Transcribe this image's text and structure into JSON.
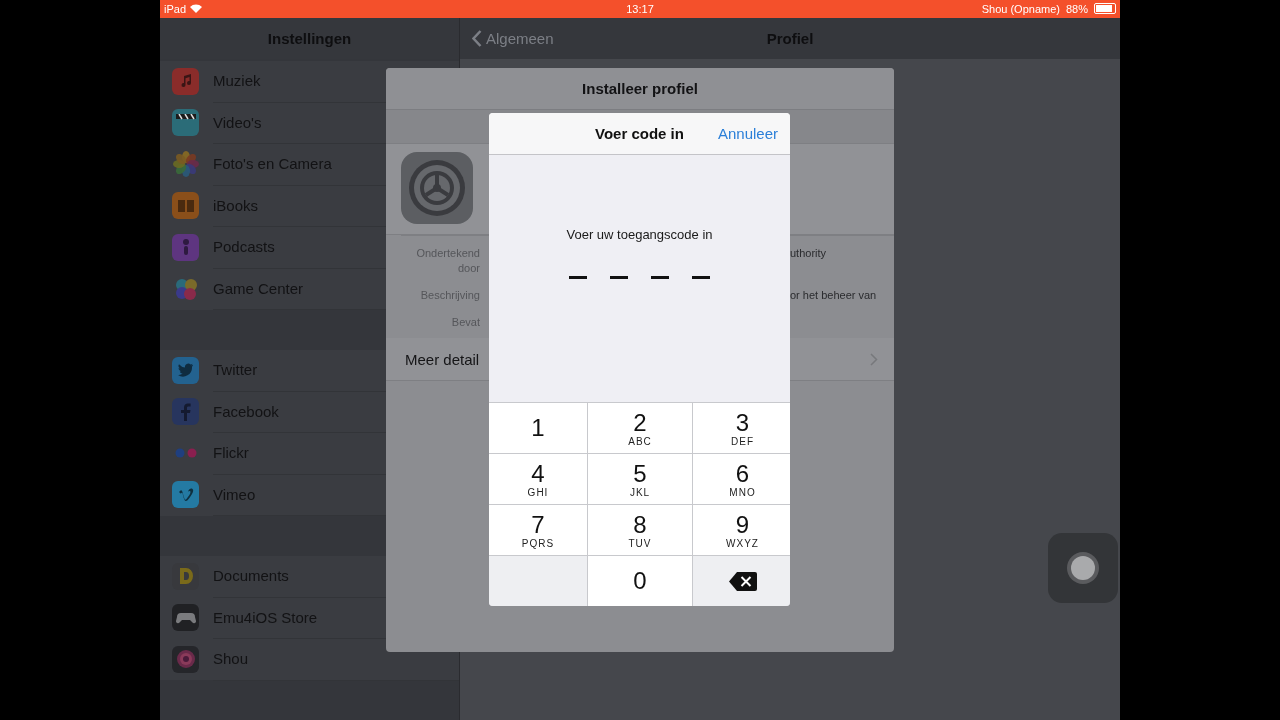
{
  "status_bar": {
    "device": "iPad",
    "time": "13:17",
    "recording": "Shou (Opname)",
    "battery": "88%"
  },
  "nav": {
    "master_title": "Instellingen",
    "back": "Algemeen",
    "detail_title": "Profiel"
  },
  "sidebar": {
    "groups": [
      {
        "items": [
          {
            "label": "Muziek",
            "kind": "music"
          },
          {
            "label": "Video's",
            "kind": "video"
          },
          {
            "label": "Foto's en Camera",
            "kind": "photos"
          },
          {
            "label": "iBooks",
            "kind": "books"
          },
          {
            "label": "Podcasts",
            "kind": "podcasts"
          },
          {
            "label": "Game Center",
            "kind": "gamecenter"
          }
        ]
      },
      {
        "items": [
          {
            "label": "Twitter",
            "kind": "twitter"
          },
          {
            "label": "Facebook",
            "kind": "facebook"
          },
          {
            "label": "Flickr",
            "kind": "flickr"
          },
          {
            "label": "Vimeo",
            "kind": "vimeo"
          }
        ]
      },
      {
        "items": [
          {
            "label": "Documents",
            "kind": "documents"
          },
          {
            "label": "Emu4iOS Store",
            "kind": "gamepad"
          },
          {
            "label": "Shou",
            "kind": "shou"
          }
        ]
      }
    ]
  },
  "profile_sheet": {
    "title": "Installeer profiel",
    "rows": [
      {
        "label": "Ondertekend door",
        "value": "uthority"
      },
      {
        "label": "Beschrijving",
        "value": "or het beheer van"
      },
      {
        "label": "Bevat"
      }
    ],
    "more": "Meer detail"
  },
  "passcode_dialog": {
    "title": "Voer code in",
    "cancel": "Annuleer",
    "prompt": "Voer uw toegangscode in",
    "slots": [
      {
        "filled": false
      },
      {
        "filled": false
      },
      {
        "filled": false
      },
      {
        "filled": false
      }
    ],
    "keys": [
      {
        "kind": "digit",
        "digit": "1"
      },
      {
        "kind": "digit",
        "digit": "2",
        "letters": "ABC"
      },
      {
        "kind": "digit",
        "digit": "3",
        "letters": "DEF"
      },
      {
        "kind": "digit",
        "digit": "4",
        "letters": "GHI"
      },
      {
        "kind": "digit",
        "digit": "5",
        "letters": "JKL"
      },
      {
        "kind": "digit",
        "digit": "6",
        "letters": "MNO"
      },
      {
        "kind": "digit",
        "digit": "7",
        "letters": "PQRS"
      },
      {
        "kind": "digit",
        "digit": "8",
        "letters": "TUV"
      },
      {
        "kind": "digit",
        "digit": "9",
        "letters": "WXYZ"
      },
      {
        "kind": "blank"
      },
      {
        "kind": "digit",
        "digit": "0"
      },
      {
        "kind": "delete"
      }
    ]
  }
}
